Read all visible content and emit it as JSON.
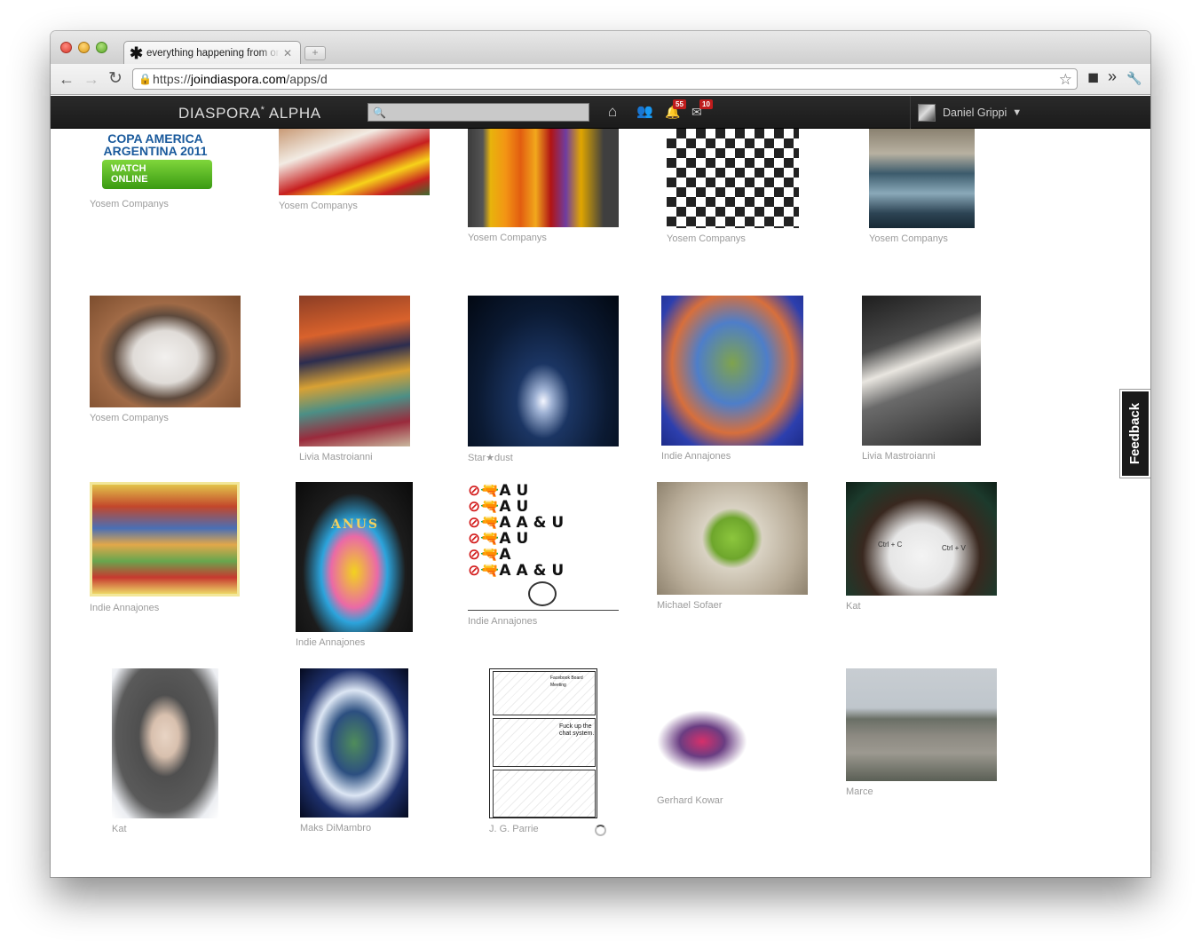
{
  "browser": {
    "tab_title": "everything happening from on",
    "tab_favicon": "✱",
    "tab_close": "✕",
    "newtab": "+",
    "url_scheme": "https://",
    "url_host": "joindiaspora.com",
    "url_path": "/apps/d",
    "back": "←",
    "forward": "→",
    "reload": "↻",
    "bookmark_star": "☆",
    "ext_cube": "◼",
    "ext_more": "»",
    "ext_wrench": "🔧"
  },
  "header": {
    "brand": "DIASPORA",
    "brand_star": "*",
    "brand_suffix": " ALPHA",
    "search_placeholder": "",
    "home_icon": "⌂",
    "contacts_icon": "👥",
    "notifications_count": "55",
    "messages_count": "10",
    "user_name": "Daniel Grippi",
    "user_caret": "▼"
  },
  "feedback": {
    "label": "Feedback"
  },
  "photos": {
    "copa": {
      "author": "Yosem Companys",
      "line1": "COPA AMERICA",
      "line2": "ARGENTINA 2011",
      "watch": "WATCH",
      "online": "ONLINE"
    },
    "ball": {
      "author": "Yosem Companys"
    },
    "crayons": {
      "author": "Yosem Companys"
    },
    "check": {
      "author": "Yosem Companys"
    },
    "waterfall": {
      "author": "Yosem Companys"
    },
    "dog": {
      "author": "Yosem Companys"
    },
    "dress": {
      "author": "Livia Mastroianni"
    },
    "moon": {
      "author": "Star★dust"
    },
    "brain": {
      "author": "Indie Annajones"
    },
    "umbrella": {
      "author": "Livia Mastroianni"
    },
    "goddess": {
      "author": "Indie Annajones"
    },
    "anus": {
      "author": "Indie Annajones",
      "label": "ANUS"
    },
    "rebus": {
      "author": "Indie Annajones",
      "lines": [
        "A U",
        "A U",
        "A A & U",
        "A U",
        "A",
        "A A & U"
      ]
    },
    "apple": {
      "author": "Michael Sofaer"
    },
    "ctrl": {
      "author": "Kat",
      "left": "Ctrl + C",
      "right": "Ctrl + V"
    },
    "baby": {
      "author": "Kat"
    },
    "cross": {
      "author": "Maks DiMambro"
    },
    "comic": {
      "author": "J. G. Parrie",
      "panel1": "Facebook Board Meeting",
      "panel2": "Fuck up the chat system."
    },
    "cartoon": {
      "author": "Gerhard Kowar"
    },
    "building": {
      "author": "Marce"
    }
  }
}
